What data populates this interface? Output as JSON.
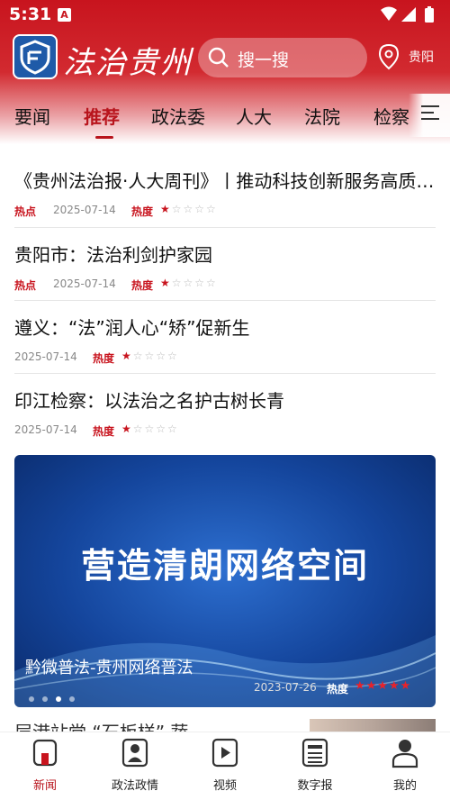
{
  "status_bar": {
    "time": "5:31",
    "notif_icon": "A"
  },
  "app": {
    "logo_text": "法治贵州",
    "search_placeholder": "搜一搜",
    "location": "贵阳"
  },
  "tabs": [
    "要闻",
    "推荐",
    "政法委",
    "人大",
    "法院",
    "检察"
  ],
  "active_tab": "推荐",
  "news": [
    {
      "title": "《贵州法治报·人大周刊》丨推动科技创新服务高质量发展",
      "hot_label": "热点",
      "date": "2025-07-14",
      "heat_label": "热度",
      "heat_level": 1
    },
    {
      "title": "贵阳市：法治利剑护家园",
      "hot_label": "热点",
      "date": "2025-07-14",
      "heat_label": "热度",
      "heat_level": 1
    },
    {
      "title": "遵义：“法”润人心“矫”促新生",
      "hot_label": "",
      "date": "2025-07-14",
      "heat_label": "热度",
      "heat_level": 1
    },
    {
      "title": "印江检察：以法治之名护古树长青",
      "hot_label": "",
      "date": "2025-07-14",
      "heat_label": "热度",
      "heat_level": 1
    }
  ],
  "banner": {
    "headline": "营造清朗网络空间",
    "caption": "黔微普法-贵州网络普法",
    "date": "2023-07-26",
    "heat_label": "热度",
    "heat_level": 5,
    "slide_count": 4,
    "active_slide": 3
  },
  "peek_title": "层港站党 “石板样” 蔬",
  "bottom_nav": [
    "新闻",
    "政法政情",
    "视频",
    "数字报",
    "我的"
  ],
  "active_nav": "新闻",
  "colors": {
    "brand_red": "#c8141e",
    "brand_blue": "#1f5aa8"
  }
}
